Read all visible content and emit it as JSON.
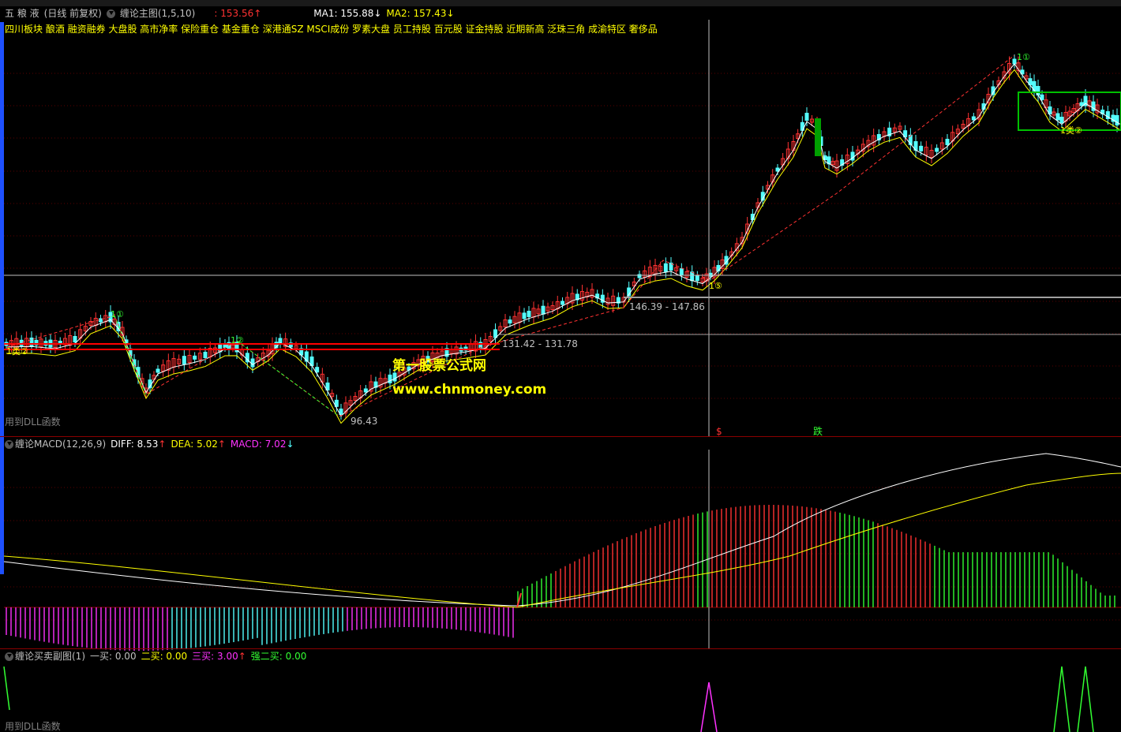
{
  "stock": {
    "name": "五 粮 液",
    "period": "(日线 前复权)",
    "indicator": "缠论主图(1,5,10)",
    "price": "153.56",
    "ma1_label": "MA1: 155.88",
    "ma2_label": "MA2: 157.43"
  },
  "boards": "四川板块 酿酒 融资融券 大盘股 高市净率 保险重仓 基金重仓 深港通SZ MSCI成份 罗素大盘 员工持股 百元股 证金持股 近期新高 泛珠三角 成渝特区 奢侈品",
  "main_annotations": {
    "range1": "146.39 - 147.86",
    "range2": "131.42 - 131.78",
    "low": "96.43",
    "dll_note": "用到DLL函数",
    "mark_s": "$",
    "mark_die": "跌",
    "sig1": "1类②",
    "sig_b1": "1①",
    "sig_b2": "1②",
    "sig_b3": "1⑤",
    "sig_top": "1①",
    "sig_r": "1类②"
  },
  "watermark": {
    "line1": "第一股票公式网",
    "line2": "www.chnmoney.com"
  },
  "macd": {
    "title": "缠论MACD(12,26,9)",
    "diff": "DIFF: 8.53",
    "dea": "DEA: 5.02",
    "macd": "MACD: 7.02"
  },
  "sub": {
    "title": "缠论买卖副图(1)",
    "b1": "一买: 0.00",
    "b2": "二买: 0.00",
    "b3": "三买: 3.00",
    "b4": "强二买: 0.00",
    "dll_note": "用到DLL函数"
  },
  "colors": {
    "up": "#ff3232",
    "down": "#54ffff",
    "ma1": "#ffffff",
    "ma2": "#ffff00",
    "macd_pos_red": "#ff3232",
    "macd_pos_green": "#32ff32",
    "macd_neg_magenta": "#ff32ff",
    "macd_neg_cyan": "#54ffff"
  }
}
